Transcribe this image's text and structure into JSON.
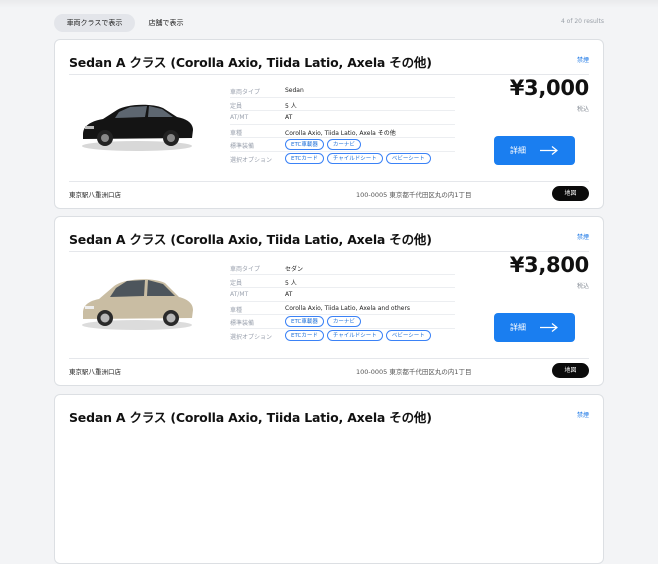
{
  "toolbar": {
    "tab_vehicle_class": "車両クラスで表示",
    "tab_store": "店舗で表示",
    "results": "4 of 20 results"
  },
  "cards": [
    {
      "title": "Sedan A クラス (Corolla Axio, Tiida Latio, Axela その他)",
      "favorite": "禁煙",
      "specs": {
        "type_label": "車両タイプ",
        "type_value": "Sedan",
        "capacity_label": "定員",
        "capacity_value": "5 人",
        "transmission_label": "AT/MT",
        "transmission_value": "AT",
        "models_label": "車種",
        "models_value": "Corolla Axio, Tiida Latio, Axela その他",
        "standard_label": "標準装備",
        "standard_chips": [
          "ETC車載器",
          "カーナビ"
        ],
        "options_label": "選択オプション",
        "option_chips": [
          "ETCカード",
          "チャイルドシート",
          "ベビーシート"
        ]
      },
      "price": "¥3,000",
      "tax": "税込",
      "detail_label": "詳細",
      "store": "東京駅八重洲口店",
      "address": "100-0005 東京都千代田区丸の内1丁目",
      "map_label": "地図",
      "car_color": "#141414"
    },
    {
      "title": "Sedan A クラス (Corolla Axio, Tiida Latio, Axela その他)",
      "favorite": "禁煙",
      "specs": {
        "type_label": "車両タイプ",
        "type_value": "セダン",
        "capacity_label": "定員",
        "capacity_value": "5 人",
        "transmission_label": "AT/MT",
        "transmission_value": "AT",
        "models_label": "車種",
        "models_value": "Corolla Axio, Tiida Latio, Axela and others",
        "standard_label": "標準装備",
        "standard_chips": [
          "ETC車載器",
          "カーナビ"
        ],
        "options_label": "選択オプション",
        "option_chips": [
          "ETCカード",
          "チャイルドシート",
          "ベビーシート"
        ]
      },
      "price": "¥3,800",
      "tax": "税込",
      "detail_label": "詳細",
      "store": "東京駅八重洲口店",
      "address": "100-0005 東京都千代田区丸の内1丁目",
      "map_label": "地図",
      "car_color": "#c9bda3"
    },
    {
      "title": "Sedan A クラス (Corolla Axio, Tiida Latio, Axela その他)",
      "favorite": "禁煙"
    }
  ],
  "colors": {
    "accent": "#1a7ef0",
    "map_button": "#0b0b0b",
    "chip_border": "#3b82f6"
  }
}
